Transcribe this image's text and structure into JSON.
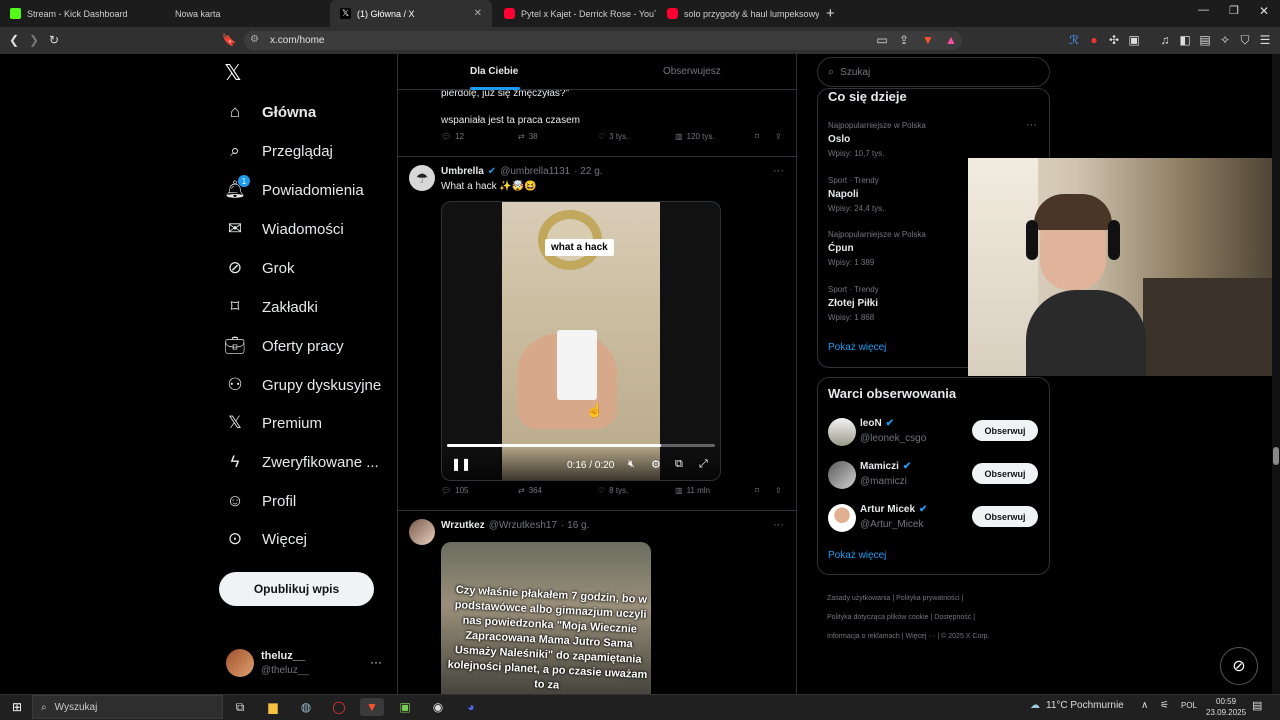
{
  "browser": {
    "tabs": [
      {
        "title": "Stream - Kick Dashboard",
        "color": "#53fc18"
      },
      {
        "title": "Nowa karta",
        "color": ""
      },
      {
        "title": "(1) Główna / X",
        "color": "#ffffff"
      },
      {
        "title": "Pytel x Kajet - Derrick Rose - YouTube",
        "color": "#ff0033"
      },
      {
        "title": "solo przygody & haul lumpeksowy -",
        "color": "#ff0033"
      }
    ],
    "new_tab": "+",
    "url": "x.com/home"
  },
  "nav": {
    "items": [
      {
        "label": "Główna",
        "icon": "home-icon"
      },
      {
        "label": "Przeglądaj",
        "icon": "search-icon"
      },
      {
        "label": "Powiadomienia",
        "icon": "bell-icon",
        "badge": "1"
      },
      {
        "label": "Wiadomości",
        "icon": "mail-icon"
      },
      {
        "label": "Grok",
        "icon": "grok-icon"
      },
      {
        "label": "Zakładki",
        "icon": "bookmark-icon"
      },
      {
        "label": "Oferty pracy",
        "icon": "briefcase-icon"
      },
      {
        "label": "Grupy dyskusyjne",
        "icon": "people-icon"
      },
      {
        "label": "Premium",
        "icon": "x-icon"
      },
      {
        "label": "Zweryfikowane ...",
        "icon": "lightning-icon"
      },
      {
        "label": "Profil",
        "icon": "person-icon"
      },
      {
        "label": "Więcej",
        "icon": "more-circle-icon"
      }
    ],
    "post_button": "Opublikuj wpis",
    "account": {
      "name": "theluz__",
      "handle": "@theluz__"
    }
  },
  "timeline": {
    "tabs": [
      "Dla Ciebie",
      "Obserwujesz"
    ],
    "prev_post": {
      "text_line1": "pierdolę, już się zmęczyłaś?\"",
      "text_line2": "wspaniała jest ta praca czasem",
      "replies": "12",
      "reposts": "38",
      "likes": "3 tys.",
      "views": "120 tys."
    },
    "post1": {
      "name": "Umbrella",
      "handle": "@umbrella1131",
      "time": "· 22 g.",
      "text": "What a hack ✨🤯😆",
      "video_caption": "what a hack",
      "video_time": "0:16 / 0:20",
      "progress": 0.8,
      "replies": "105",
      "reposts": "364",
      "likes": "8 tys.",
      "views": "11 mln"
    },
    "post2": {
      "name": "Wrzutkez",
      "handle": "@Wrzutkesh17",
      "time": "· 16 g.",
      "image_text": "Czy właśnie płakałem 7 godzin, bo w podstawówce albo gimnazjum uczyli nas powiedzonka \"Moja Wiecznie Zapracowana Mama Jutro Sama Usmaży Naleśniki\" do zapamiętania kolejności planet, a po czasie uważam to za"
    }
  },
  "search": {
    "placeholder": "Szukaj"
  },
  "trends": {
    "title": "Co się dzieje",
    "items": [
      {
        "meta": "Najpopularniejsze w Polska",
        "name": "Oslo",
        "count": "Wpisy: 10,7 tys."
      },
      {
        "meta": "Sport · Trendy",
        "name": "Napoli",
        "count": "Wpisy: 24,4 tys."
      },
      {
        "meta": "Najpopularniejsze w Polska",
        "name": "Ćpun",
        "count": "Wpisy: 1 389"
      },
      {
        "meta": "Sport · Trendy",
        "name": "Złotej Piłki",
        "count": "Wpisy: 1 868"
      }
    ],
    "show_more": "Pokaż więcej"
  },
  "who_to_follow": {
    "title": "Warci obserwowania",
    "items": [
      {
        "name": "leoN",
        "handle": "@leonek_csgo"
      },
      {
        "name": "Mamiczi",
        "handle": "@mamiczi"
      },
      {
        "name": "Artur Micek",
        "handle": "@Artur_Micek"
      }
    ],
    "follow_label": "Obserwuj",
    "show_more": "Pokaż więcej"
  },
  "footer": {
    "links": [
      "Zasady użytkowania",
      "Polityka prywatności",
      "Polityka dotycząca plików cookie",
      "Dostępność",
      "Informacja o reklamach",
      "Więcej ···",
      "© 2025 X Corp."
    ]
  },
  "taskbar": {
    "search": "Wyszukaj",
    "weather": "11°C  Pochmurnie",
    "lang": "POL",
    "time": "00:59",
    "date": "23.09.2025"
  },
  "colors": {
    "accent": "#1d9bf0",
    "verified": "#1d9bf0"
  }
}
